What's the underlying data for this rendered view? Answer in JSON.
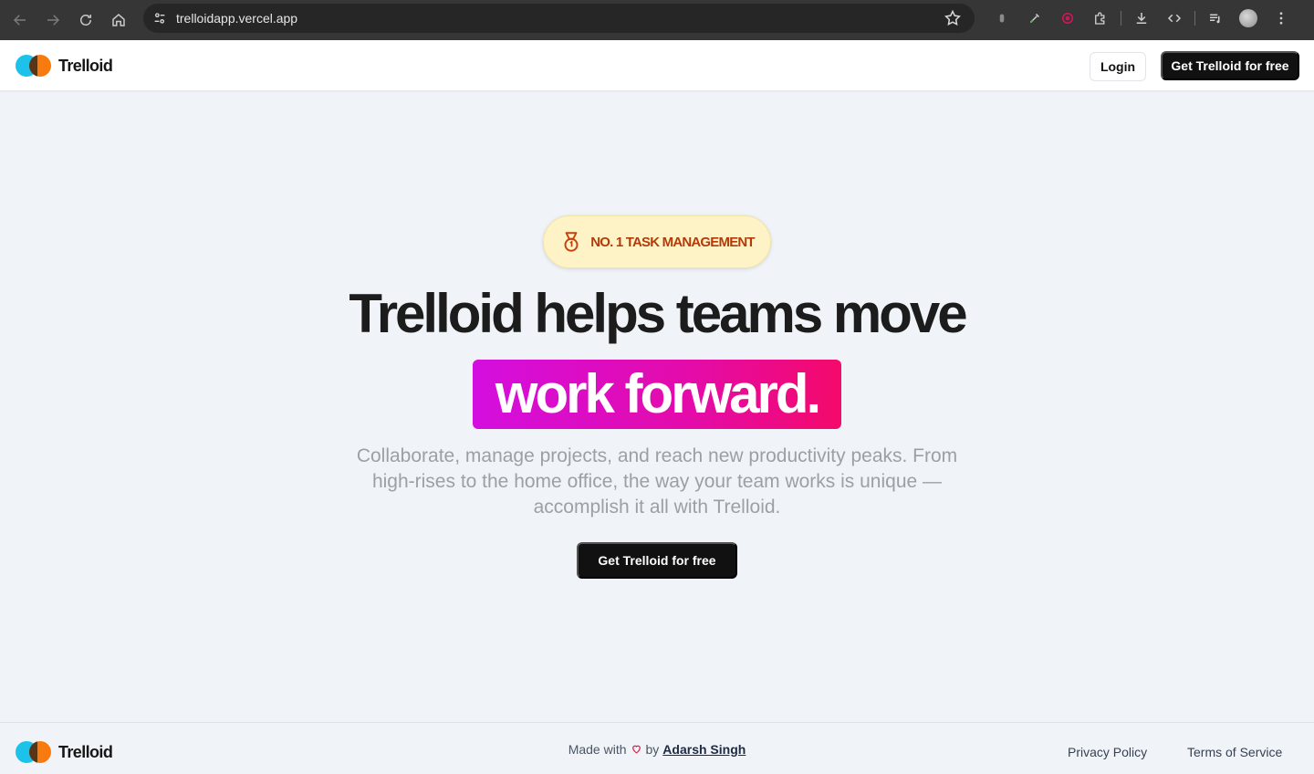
{
  "browser": {
    "url": "trelloidapp.vercel.app"
  },
  "navbar": {
    "brand": "Trelloid",
    "login_label": "Login",
    "cta_label": "Get Trelloid for free"
  },
  "hero": {
    "badge": "NO. 1 TASK MANAGEMENT",
    "headline": "Trelloid helps teams move",
    "highlight": "work forward.",
    "subtext": "Collaborate, manage projects, and reach new productivity peaks. From high-rises to the home office, the way your team works is unique — accomplish it all with Trelloid.",
    "cta_label": "Get Trelloid for free"
  },
  "footer": {
    "brand": "Trelloid",
    "made_with": "Made with",
    "by": "by",
    "author": "Adarsh Singh",
    "privacy": "Privacy Policy",
    "terms": "Terms of Service"
  },
  "colors": {
    "logo_blue": "#1dc2ea",
    "logo_orange": "#f77b0f",
    "highlight_start": "#d40ee0",
    "highlight_end": "#f40a6a",
    "badge_bg": "#fef3c7",
    "badge_text": "#b23b08"
  }
}
